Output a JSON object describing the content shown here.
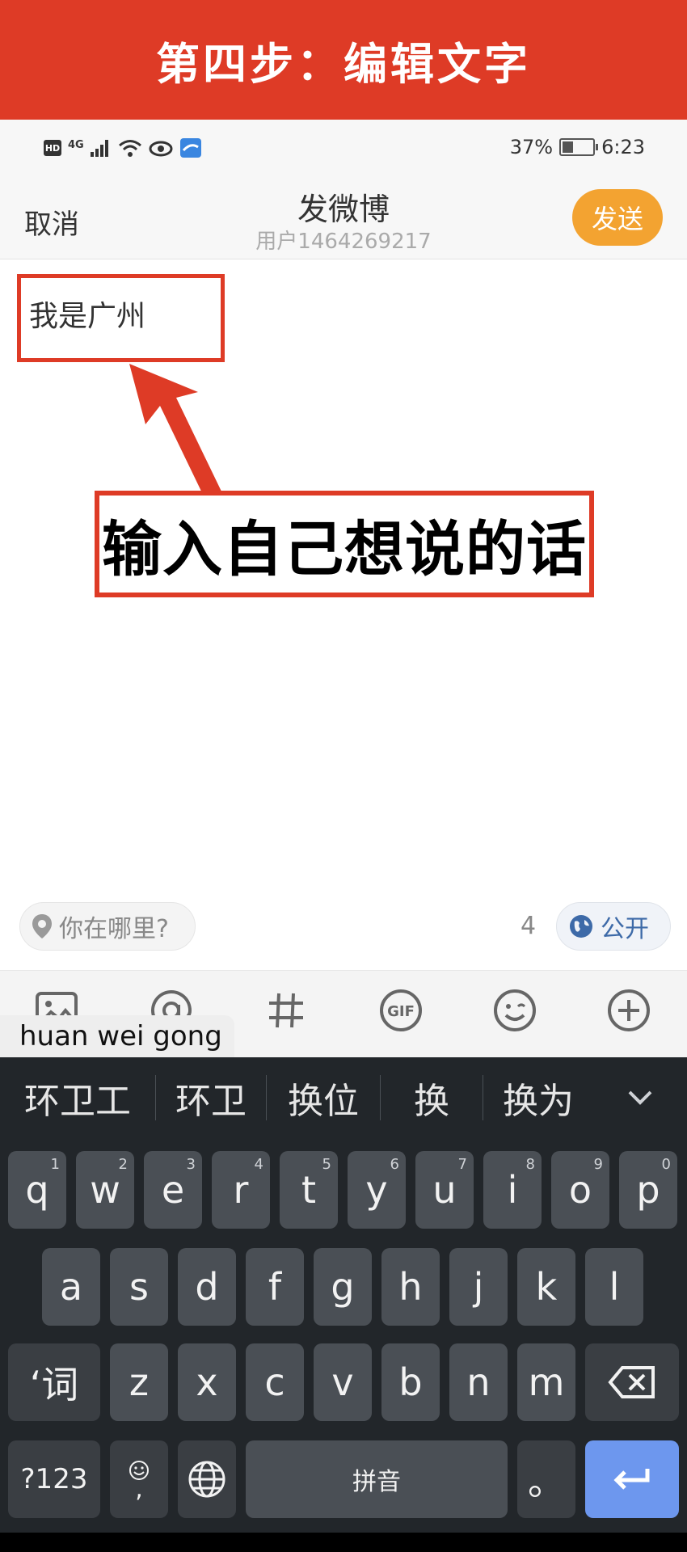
{
  "banner": {
    "title": "第四步：编辑文字"
  },
  "status": {
    "hd": "HD",
    "net": "4G",
    "battery_pct": "37%",
    "time": "6:23"
  },
  "header": {
    "cancel": "取消",
    "title": "发微博",
    "subtitle": "用户1464269217",
    "send": "发送"
  },
  "compose": {
    "text": "我是广州",
    "callout": "输入自己想说的话"
  },
  "location": {
    "placeholder": "你在哪里?"
  },
  "word_count": "4",
  "visibility": {
    "label": "公开"
  },
  "toolbar": {
    "icons": [
      "image-icon",
      "at-icon",
      "hashtag-icon",
      "gif-icon",
      "emoji-icon",
      "plus-icon"
    ],
    "gif_label": "GIF"
  },
  "ime": {
    "pinyin": "huan wei gong",
    "candidates": [
      "环卫工",
      "环卫",
      "换位",
      "换",
      "换为"
    ],
    "row1": [
      {
        "k": "q",
        "h": "1"
      },
      {
        "k": "w",
        "h": "2"
      },
      {
        "k": "e",
        "h": "3"
      },
      {
        "k": "r",
        "h": "4"
      },
      {
        "k": "t",
        "h": "5"
      },
      {
        "k": "y",
        "h": "6"
      },
      {
        "k": "u",
        "h": "7"
      },
      {
        "k": "i",
        "h": "8"
      },
      {
        "k": "o",
        "h": "9"
      },
      {
        "k": "p",
        "h": "0"
      }
    ],
    "row2": [
      "a",
      "s",
      "d",
      "f",
      "g",
      "h",
      "j",
      "k",
      "l"
    ],
    "row3": [
      "z",
      "x",
      "c",
      "v",
      "b",
      "n",
      "m"
    ],
    "word_key": "‘词",
    "sym_key": "?123",
    "comma_key": ",",
    "space": "拼音",
    "period": "。"
  },
  "colors": {
    "banner": "#de3b26",
    "send": "#f3a331",
    "keyboard_bg": "#22262a",
    "key": "#4a4f55",
    "enter": "#6d97ee"
  }
}
